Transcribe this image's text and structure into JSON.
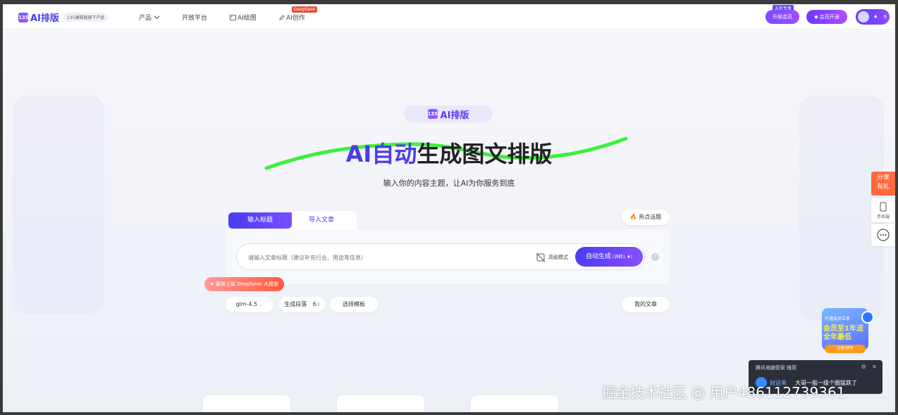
{
  "header": {
    "logo_mark": "135",
    "logo_text": "AI排版",
    "logo_sub": "135编辑器旗下产品",
    "nav": {
      "product": "产品",
      "open_platform": "开放平台",
      "ai_draw": "AI绘图",
      "ai_create": "AI创作",
      "deepseek_badge": "DeepSeek"
    },
    "upgrade_tag": "五折专享",
    "upgrade_label": "升级会员",
    "vip_label": "会员开通",
    "user_count": "9"
  },
  "hero": {
    "badge": "AI排版",
    "title_accent": "AI自动",
    "title_rest": "生成图文排版",
    "subtitle": "输入你的内容主题，让AI为你服务到底"
  },
  "editor": {
    "tab_input": "输入标题",
    "tab_import": "导入文章",
    "hot_topics": "热点话题",
    "input_placeholder": "请输入文章标题（建议补充行业、用途等信息）",
    "advanced_mode": "高级模式",
    "generate_label": "自动生成",
    "generate_cost": "(消耗1",
    "deepseek_promo": "最新上架 DeepSeek 大模型",
    "model": "glm-4.5",
    "paragraphs_label": "生成段落",
    "paragraphs_value": "6",
    "choose_template": "选择模板",
    "my_articles": "我的文章"
  },
  "side": {
    "share_line1": "分享",
    "share_line2": "有礼",
    "mobile": "手机端"
  },
  "promo": {
    "line1": "开通会员立享",
    "line2": "会员至1年送",
    "line3": "全年最低",
    "button": "立即领专"
  },
  "notice": {
    "head": "腾讯电脑管家·推荐",
    "name": "财运来",
    "message": "大哥一般一级个圈猛跌了"
  },
  "watermark": "掘金技术社区 @ 用户486112739361",
  "colors": {
    "brand": "#4b3cf0",
    "brand_purple": "#8a4dff",
    "accent_green": "#3ef03a",
    "hot": "#ff5a1f"
  }
}
